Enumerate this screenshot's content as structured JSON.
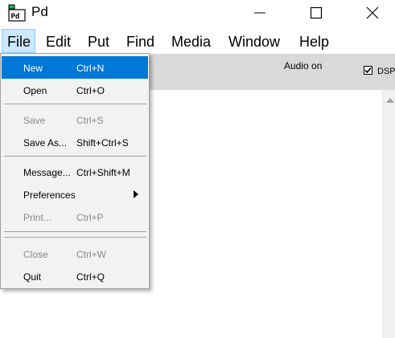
{
  "window": {
    "title": "Pd",
    "icon": "pd-app-icon",
    "icon_text": "Pd",
    "controls": {
      "minimize": "minimize-icon",
      "maximize": "maximize-icon",
      "close": "close-icon"
    }
  },
  "menubar": {
    "items": [
      {
        "label": "File",
        "active": true
      },
      {
        "label": "Edit"
      },
      {
        "label": "Put"
      },
      {
        "label": "Find"
      },
      {
        "label": "Media"
      },
      {
        "label": "Window"
      },
      {
        "label": "Help"
      }
    ]
  },
  "main": {
    "audio_status": "Audio on",
    "dsp_label": "DSP",
    "dsp_checked": true
  },
  "file_menu": {
    "items": [
      {
        "label": "New",
        "accel": "Ctrl+N",
        "highlighted": true
      },
      {
        "label": "Open",
        "accel": "Ctrl+O"
      },
      {
        "label": "Save",
        "accel": "Ctrl+S",
        "disabled": true
      },
      {
        "label": "Save As...",
        "accel": "Shift+Ctrl+S"
      },
      {
        "label": "Message...",
        "accel": "Ctrl+Shift+M"
      },
      {
        "label": "Preferences",
        "submenu": true
      },
      {
        "label": "Print...",
        "accel": "Ctrl+P",
        "disabled": true
      },
      {
        "label": "Close",
        "accel": "Ctrl+W",
        "disabled": true
      },
      {
        "label": "Quit",
        "accel": "Ctrl+Q"
      }
    ]
  },
  "colors": {
    "highlight": "#0078d7",
    "menu_bg": "#f2f2f2",
    "strip_bg": "#d9d9d9",
    "disabled_text": "#8a8a8a"
  }
}
